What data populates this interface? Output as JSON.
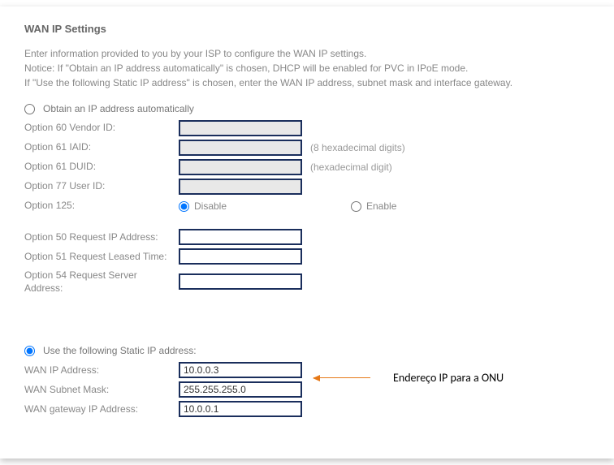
{
  "title": "WAN IP Settings",
  "intro": {
    "line1": "Enter information provided to you by your ISP to configure the WAN IP settings.",
    "line2": "Notice: If \"Obtain an IP address automatically\" is chosen, DHCP will be enabled for PVC in IPoE mode.",
    "line3": "If \"Use the following Static IP address\" is chosen, enter the WAN IP address, subnet mask and interface gateway."
  },
  "auto": {
    "radio_label": "Obtain an IP address automatically",
    "opt60_label": "Option 60 Vendor ID:",
    "opt60_value": "",
    "opt61_iaid_label": "Option 61 IAID:",
    "opt61_iaid_value": "",
    "opt61_iaid_hint": "(8 hexadecimal digits)",
    "opt61_duid_label": "Option 61 DUID:",
    "opt61_duid_value": "",
    "opt61_duid_hint": "(hexadecimal digit)",
    "opt77_label": "Option 77 User ID:",
    "opt77_value": "",
    "opt125_label": "Option 125:",
    "opt125_disable": "Disable",
    "opt125_enable": "Enable",
    "opt50_label": "Option 50 Request IP Address:",
    "opt50_value": "",
    "opt51_label": "Option 51 Request Leased Time:",
    "opt51_value": "",
    "opt54_label": "Option 54 Request Server Address:",
    "opt54_value": ""
  },
  "static": {
    "radio_label": "Use the following Static IP address:",
    "wan_ip_label": "WAN IP Address:",
    "wan_ip_value": "10.0.0.3",
    "subnet_label": "WAN Subnet Mask:",
    "subnet_value": "255.255.255.0",
    "gateway_label": "WAN gateway IP Address:",
    "gateway_value": "10.0.0.1"
  },
  "annotation": "Endereço IP para a ONU"
}
